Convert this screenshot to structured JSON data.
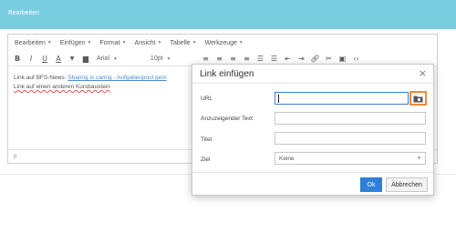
{
  "header": {
    "title": "Bearbeiten"
  },
  "editor": {
    "menubar": [
      {
        "label": "Bearbeiten"
      },
      {
        "label": "Einfügen"
      },
      {
        "label": "Format"
      },
      {
        "label": "Ansicht"
      },
      {
        "label": "Tabelle"
      },
      {
        "label": "Werkzeuge"
      }
    ],
    "toolbar": {
      "bold": "B",
      "italic": "I",
      "underline": "U",
      "text_color": "A",
      "font_family": "Arial",
      "font_size": "10pt"
    },
    "content": {
      "line1_prefix": "Link auf BFS-News: ",
      "line1_link": "Sharing is caring - Aufgabenpool gem",
      "line2": "Link auf einen anderen Kursbaustein"
    },
    "status_path": "p"
  },
  "dialog": {
    "title": "Link einfügen",
    "close": "×",
    "fields": {
      "url_label": "URL",
      "url_value": "",
      "text_label": "Anzuzeigender Text",
      "text_value": "",
      "title_label": "Titel",
      "title_value": "",
      "target_label": "Ziel",
      "target_value": "Keine"
    },
    "ok_label": "Ok",
    "cancel_label": "Abbrechen"
  },
  "colors": {
    "topbar": "#79cde1",
    "accent": "#2f7fd7",
    "browse_highlight": "#f08a3a",
    "link": "#4a8ed0"
  },
  "icons": [
    "align-left-icon",
    "align-center-icon",
    "align-right-icon",
    "align-justify-icon",
    "bullet-list-icon",
    "numbered-list-icon",
    "outdent-icon",
    "indent-icon",
    "link-icon",
    "unlink-icon",
    "image-icon",
    "code-icon",
    "browse-folder-icon",
    "close-icon"
  ]
}
